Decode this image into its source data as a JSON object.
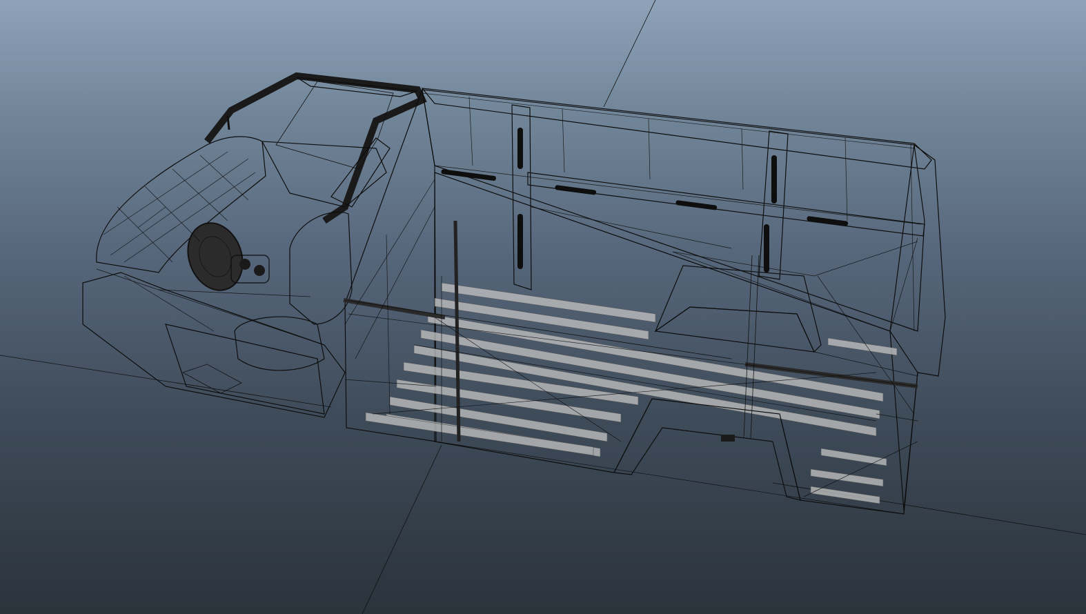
{
  "viewport": {
    "view": "perspective",
    "background_top": "#8ea3b8",
    "background_bottom": "#2b333b",
    "display_mode": "shaded-wireframe"
  },
  "scene": {
    "model": "van body shell",
    "parts": [
      "cab",
      "dashboard",
      "steering-wheel",
      "driver-seat",
      "cargo-bay",
      "cargo-floor",
      "wheel-arch-left",
      "wheel-arch-right",
      "rear-cabinet",
      "bulkhead-rails"
    ]
  },
  "colors": {
    "body": "#2c2c2c",
    "floor": "#8a8a8a",
    "floor_slat": "#b8b8b8",
    "wire": "#0d0d0d"
  }
}
